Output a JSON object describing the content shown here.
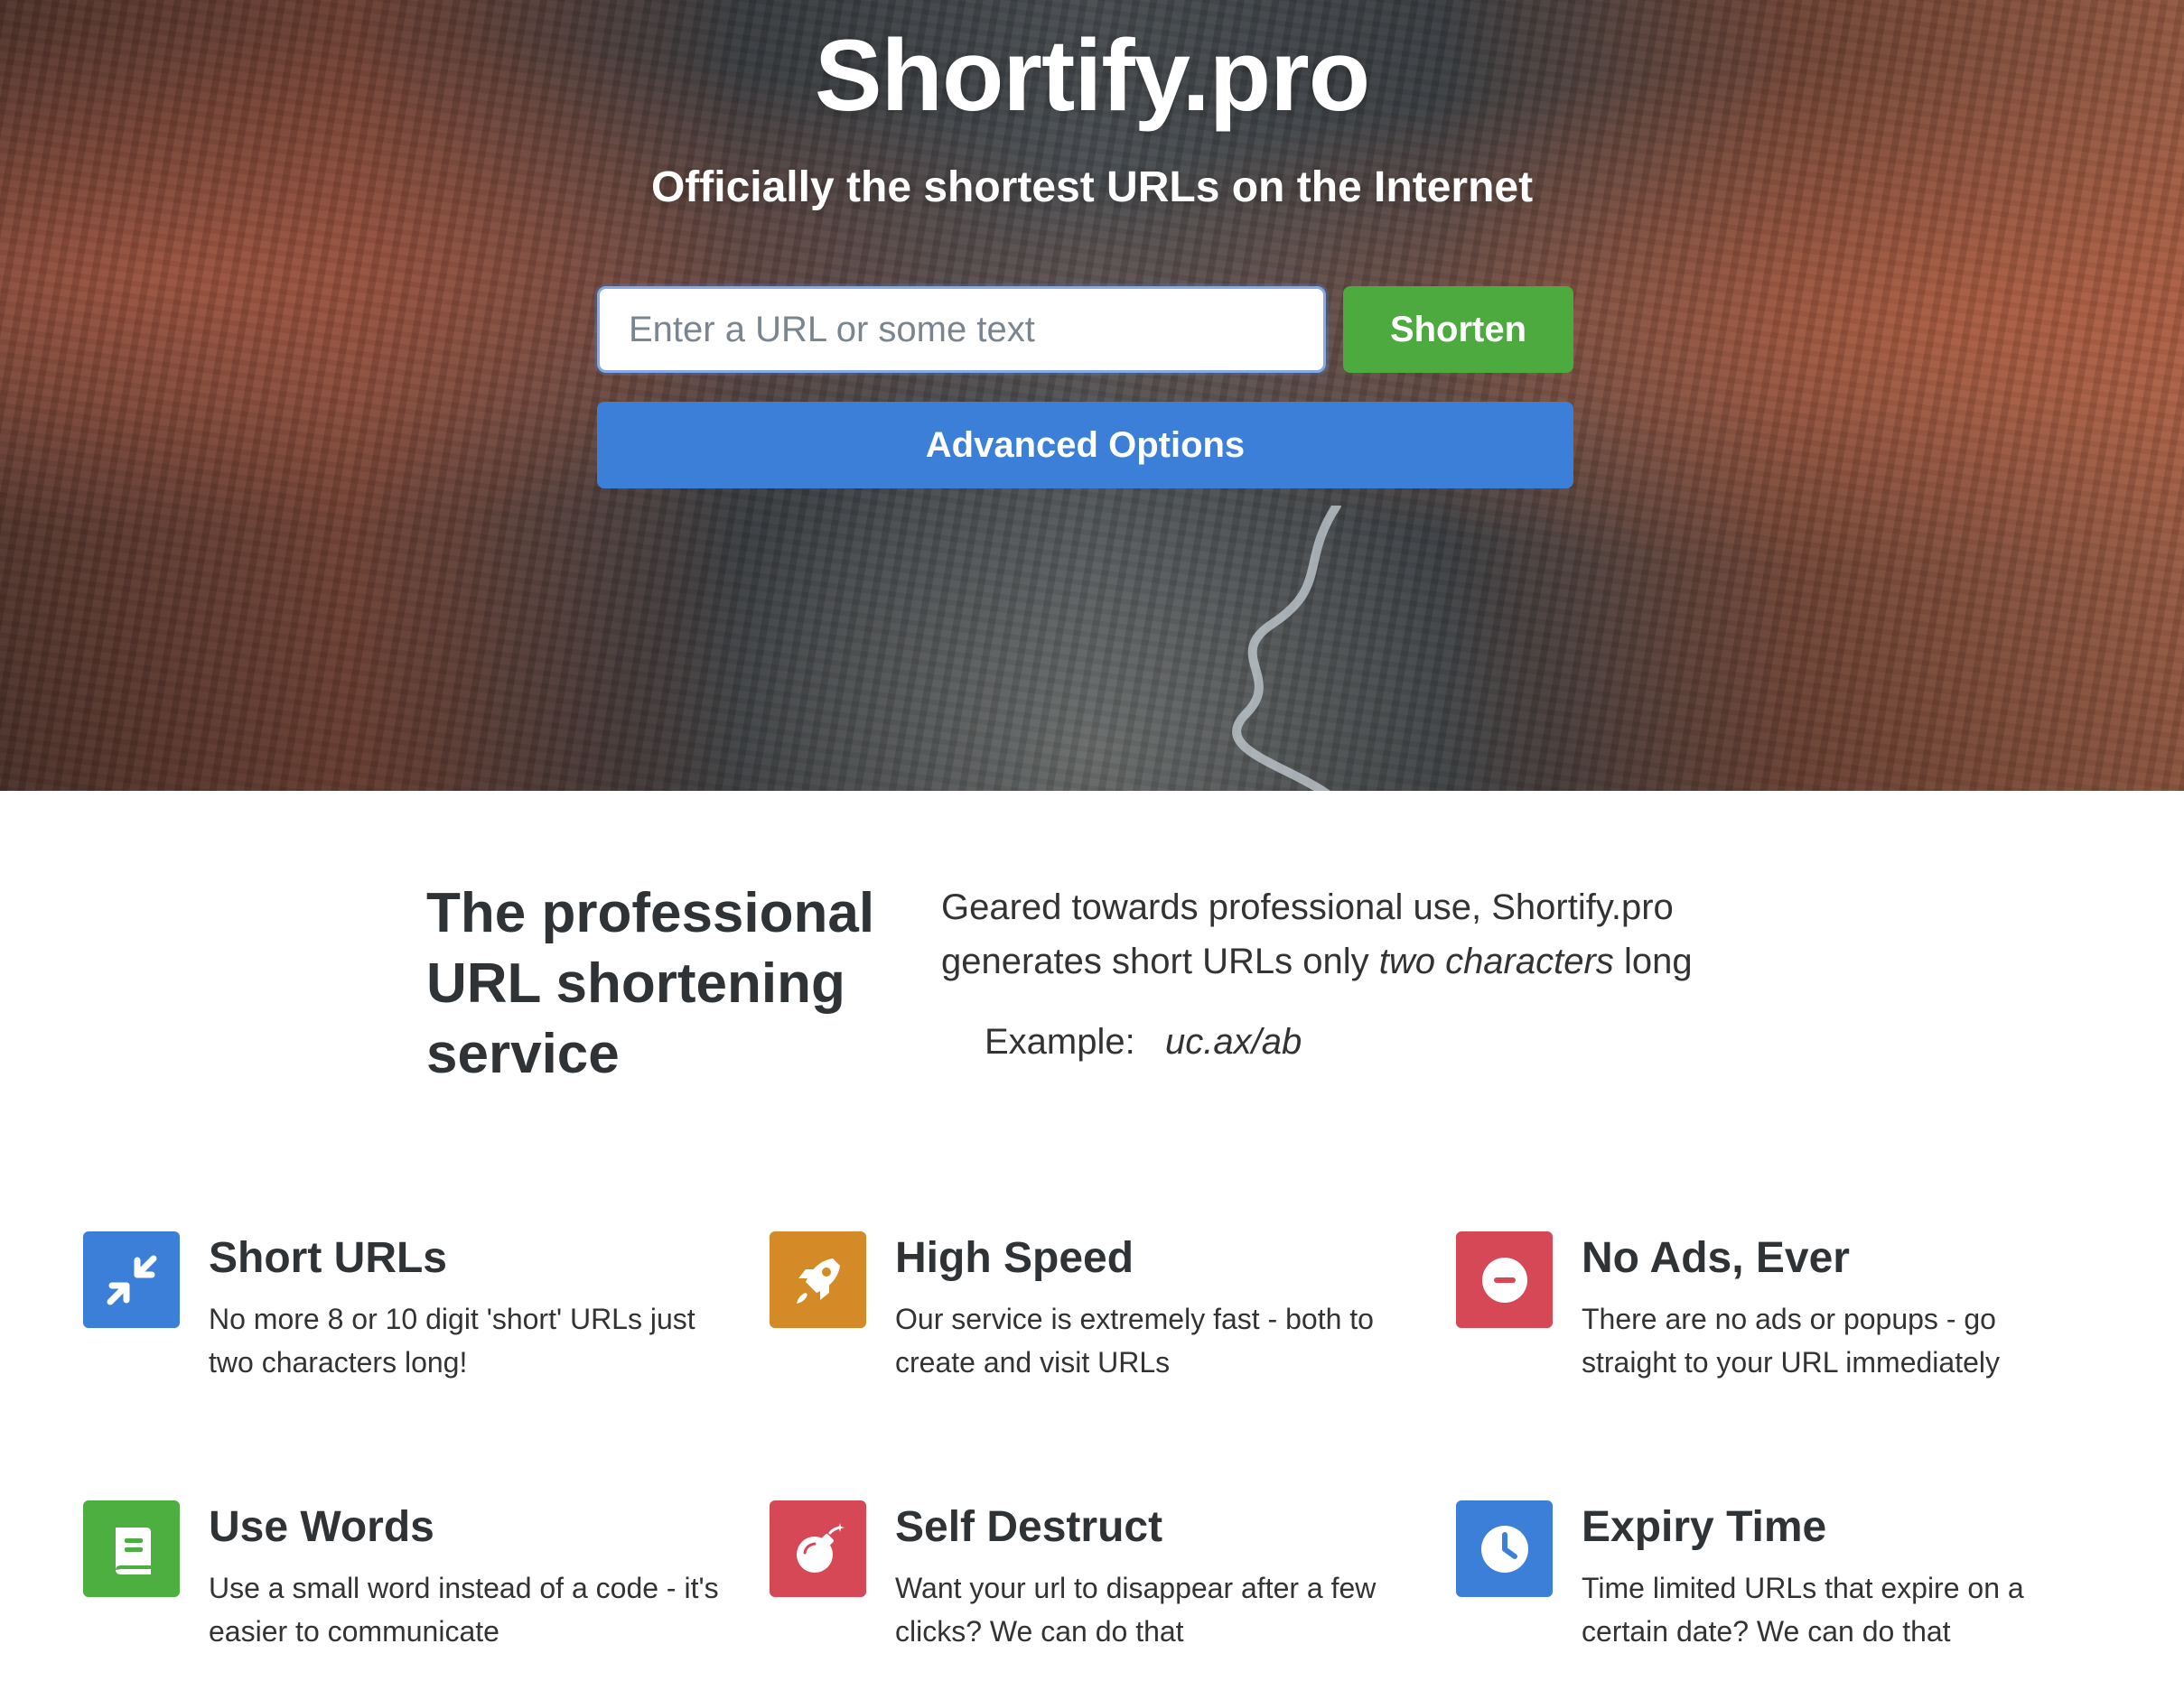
{
  "hero": {
    "brand": "Shortify.pro",
    "tagline": "Officially the shortest URLs on the Internet",
    "input_placeholder": "Enter a URL or some text",
    "input_value": "",
    "shorten_label": "Shorten",
    "advanced_label": "Advanced Options"
  },
  "intro": {
    "heading": "The professional URL shortening service",
    "text_prefix": "Geared towards professional use, Shortify.pro generates short URLs only",
    "text_emphasis": "two characters",
    "text_suffix": "long",
    "example_label": "Example:",
    "example_value": "uc.ax/ab"
  },
  "features": [
    {
      "title": "Short URLs",
      "description": "No more 8 or 10 digit 'short' URLs just two characters long!",
      "icon": "compress-arrows-icon",
      "color": "#3b7fd8"
    },
    {
      "title": "High Speed",
      "description": "Our service is extremely fast - both to create and visit URLs",
      "icon": "rocket-icon",
      "color": "#d58a28"
    },
    {
      "title": "No Ads, Ever",
      "description": "There are no ads or popups - go straight to your URL immediately",
      "icon": "minus-circle-icon",
      "color": "#d64856"
    },
    {
      "title": "Use Words",
      "description": "Use a small word instead of a code - it's easier to communicate",
      "icon": "book-icon",
      "color": "#4caf3f"
    },
    {
      "title": "Self Destruct",
      "description": "Want your url to disappear after a few clicks? We can do that",
      "icon": "bomb-icon",
      "color": "#d64856"
    },
    {
      "title": "Expiry Time",
      "description": "Time limited URLs that expire on a certain date? We can do that",
      "icon": "clock-icon",
      "color": "#3b7fd8"
    }
  ]
}
